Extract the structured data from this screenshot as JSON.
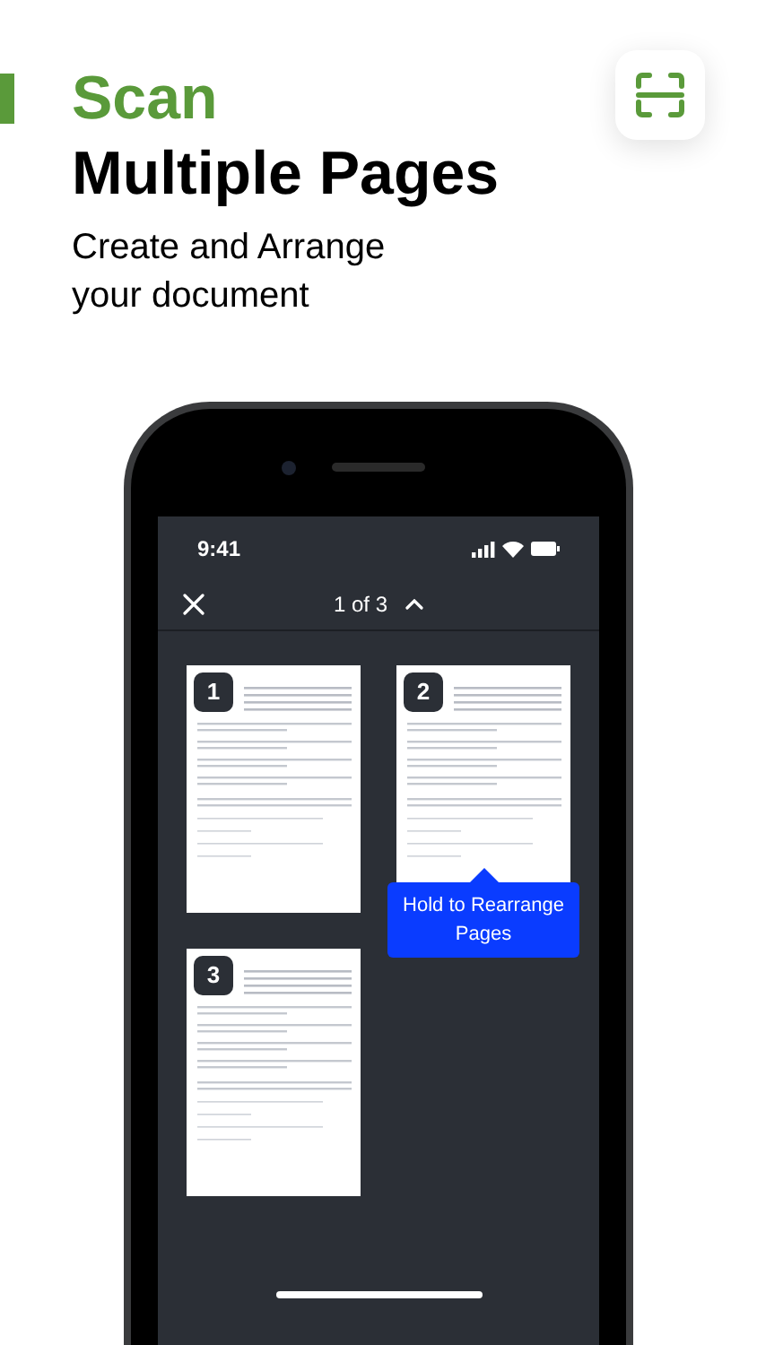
{
  "headline": {
    "accent": "Scan",
    "title": "Multiple Pages",
    "subtitle": "Create and Arrange your document"
  },
  "status_bar": {
    "time": "9:41"
  },
  "nav": {
    "counter": "1 of 3"
  },
  "pages": [
    {
      "number": "1"
    },
    {
      "number": "2",
      "tooltip": "Hold to Rearrange Pages"
    },
    {
      "number": "3"
    }
  ]
}
